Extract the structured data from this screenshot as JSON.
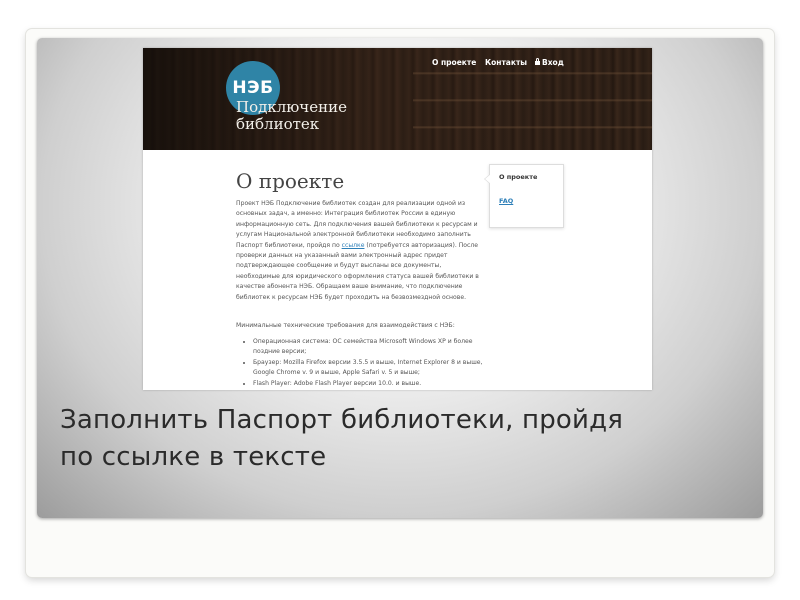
{
  "site": {
    "logo_text": "НЭБ",
    "title_line1": "Подключение",
    "title_line2": "библиотек"
  },
  "nav": {
    "about": "О проекте",
    "contacts": "Контакты",
    "login": "Вход"
  },
  "content": {
    "heading": "О проекте",
    "paragraph_before_link": "Проект НЭБ Подключение библиотек создан для реализации одной из основных задач, а именно: Интеграция библиотек России в единую информационную сеть. Для подключения вашей библиотеки к ресурсам и услугам Национальной электронной библиотеки необходимо заполнить Паспорт библиотеки, пройдя по ",
    "link_text": "ссылке",
    "paragraph_after_link": " (потребуется авторизация). После проверки данных на указанный вами электронный адрес придет подтверждающее сообщение и будут высланы все документы, необходимые для юридического оформления статуса вашей библиотеки в качестве абонента НЭБ. Обращаем ваше внимание, что подключение библиотек к ресурсам НЭБ будет проходить на безвозмездной основе.",
    "requirements_intro": "Минимальные технические требования для взаимодействия с НЭБ:",
    "requirements": [
      "Операционная система: ОС семейства Microsoft Windows XP и более поздние версии;",
      "Браузер: Mozilla Firefox версии 3.5.5 и выше, Internet Explorer 8 и выше, Google Chrome v. 9 и выше, Apple Safari v. 5 и выше;",
      "Flash Player: Adobe Flash Player версии 10.0. и выше."
    ]
  },
  "sidebar": {
    "title": "О проекте",
    "faq": "FAQ"
  },
  "caption": {
    "line1": "Заполнить Паспорт библиотеки, пройдя",
    "line2": "по ссылке в тексте"
  }
}
